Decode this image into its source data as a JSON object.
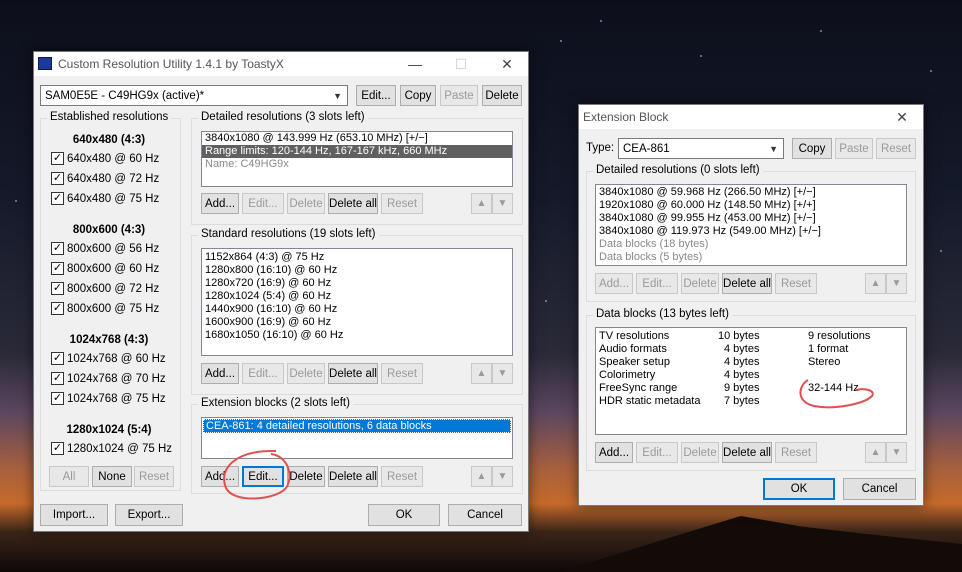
{
  "cru": {
    "title": "Custom Resolution Utility 1.4.1 by ToastyX",
    "monitor": "SAM0E5E - C49HG9x (active)*",
    "top_buttons": [
      "Edit...",
      "Copy",
      "Paste",
      "Delete"
    ],
    "established": {
      "label": "Established resolutions",
      "groups": [
        {
          "header": "640x480 (4:3)",
          "items": [
            "640x480 @ 60 Hz",
            "640x480 @ 72 Hz",
            "640x480 @ 75 Hz"
          ]
        },
        {
          "header": "800x600 (4:3)",
          "items": [
            "800x600 @ 56 Hz",
            "800x600 @ 60 Hz",
            "800x600 @ 72 Hz",
            "800x600 @ 75 Hz"
          ]
        },
        {
          "header": "1024x768 (4:3)",
          "items": [
            "1024x768 @ 60 Hz",
            "1024x768 @ 70 Hz",
            "1024x768 @ 75 Hz"
          ]
        },
        {
          "header": "1280x1024 (5:4)",
          "items": [
            "1280x1024 @ 75 Hz"
          ]
        }
      ],
      "buttons": [
        "All",
        "None",
        "Reset"
      ]
    },
    "detailed": {
      "label": "Detailed resolutions (3 slots left)",
      "items": [
        "3840x1080 @ 143.999 Hz (653.10 MHz) [+/−]",
        "Range limits: 120-144 Hz, 167-167 kHz, 660 MHz",
        "Name: C49HG9x"
      ]
    },
    "standard": {
      "label": "Standard resolutions (19 slots left)",
      "items": [
        "1152x864 (4:3) @ 75 Hz",
        "1280x800 (16:10) @ 60 Hz",
        "1280x720 (16:9) @ 60 Hz",
        "1280x1024 (5:4) @ 60 Hz",
        "1440x900 (16:10) @ 60 Hz",
        "1600x900 (16:9) @ 60 Hz",
        "1680x1050 (16:10) @ 60 Hz"
      ]
    },
    "extension": {
      "label": "Extension blocks (2 slots left)",
      "items": [
        "CEA-861: 4 detailed resolutions, 6 data blocks"
      ]
    },
    "list_buttons": [
      "Add...",
      "Edit...",
      "Delete",
      "Delete all",
      "Reset"
    ],
    "arrows": [
      "▲",
      "▼"
    ],
    "bottom_buttons": [
      "Import...",
      "Export...",
      "OK",
      "Cancel"
    ]
  },
  "ext": {
    "title": "Extension Block",
    "type_label": "Type:",
    "type_value": "CEA-861",
    "type_buttons": [
      "Copy",
      "Paste",
      "Reset"
    ],
    "detailed": {
      "label": "Detailed resolutions (0 slots left)",
      "items": [
        "3840x1080 @ 59.968 Hz (266.50 MHz) [+/−]",
        "1920x1080 @ 60.000 Hz (148.50 MHz) [+/+]",
        "3840x1080 @ 99.955 Hz (453.00 MHz) [+/−]",
        "3840x1080 @ 119.973 Hz (549.00 MHz) [+/−]",
        "Data blocks (18 bytes)",
        "Data blocks (5 bytes)"
      ]
    },
    "datablocks": {
      "label": "Data blocks (13 bytes left)",
      "rows": [
        {
          "name": "TV resolutions",
          "size": "10 bytes",
          "info": "9 resolutions"
        },
        {
          "name": "Audio formats",
          "size": "4 bytes",
          "info": "1 format"
        },
        {
          "name": "Speaker setup",
          "size": "4 bytes",
          "info": "Stereo"
        },
        {
          "name": "Colorimetry",
          "size": "4 bytes",
          "info": ""
        },
        {
          "name": "FreeSync range",
          "size": "9 bytes",
          "info": "32-144 Hz"
        },
        {
          "name": "HDR static metadata",
          "size": "7 bytes",
          "info": ""
        }
      ]
    },
    "list_buttons": [
      "Add...",
      "Edit...",
      "Delete",
      "Delete all",
      "Reset"
    ],
    "arrows": [
      "▲",
      "▼"
    ],
    "bottom_buttons": [
      "OK",
      "Cancel"
    ]
  },
  "titlebar_glyphs": [
    "—",
    "☐",
    "✕"
  ],
  "checkmark": "✓",
  "annotation_color": "#e05050"
}
